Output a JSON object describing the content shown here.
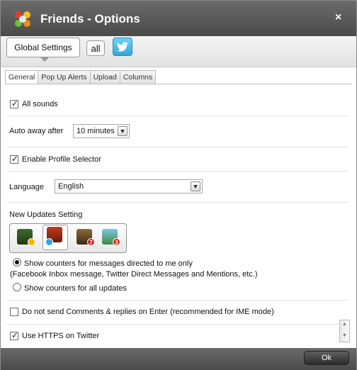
{
  "window": {
    "title": "Friends - Options",
    "close_label": "×"
  },
  "toolbar": {
    "global_settings_label": "Global Settings",
    "all_label": "all",
    "twitter_icon": "twitter-bird-icon"
  },
  "tabs": [
    {
      "label": "General",
      "active": true
    },
    {
      "label": "Pop Up Alerts",
      "active": false
    },
    {
      "label": "Upload",
      "active": false
    },
    {
      "label": "Columns",
      "active": false
    }
  ],
  "settings": {
    "all_sounds": {
      "label": "All sounds",
      "checked": true
    },
    "auto_away": {
      "label": "Auto away after",
      "value": "10 minutes"
    },
    "profile_selector": {
      "label": "Enable Profile Selector",
      "checked": true
    },
    "language": {
      "label": "Language",
      "value": "English"
    },
    "new_updates": {
      "label": "New Updates Setting",
      "profiles": [
        {
          "name": "profile-1",
          "badge": ""
        },
        {
          "name": "profile-2",
          "badge": "",
          "selected": true
        },
        {
          "name": "profile-3",
          "badge": "7"
        },
        {
          "name": "profile-4",
          "badge": "3"
        }
      ],
      "option_directed": "Show counters for messages directed to me only",
      "option_directed_note": "(Facebook Inbox message, Twitter Direct Messages and Mentions, etc.)",
      "option_all": "Show counters for all updates",
      "selected_option": "directed"
    },
    "no_send_enter": {
      "label": "Do not send Comments & replies on Enter (recommended for IME mode)",
      "checked": false
    },
    "https_twitter": {
      "label": "Use HTTPS on Twitter",
      "checked": true
    }
  },
  "footer": {
    "ok_label": "Ok"
  },
  "colors": {
    "titlebar": "#555555",
    "twitter_blue": "#2fa7db",
    "badge_red": "#d6231f"
  }
}
